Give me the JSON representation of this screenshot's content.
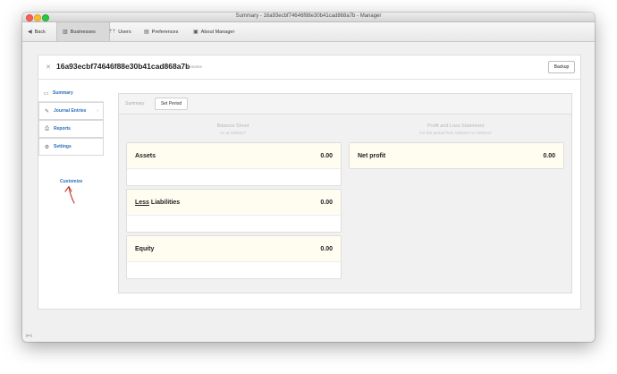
{
  "window": {
    "title": "Summary - 16a93ecbf74646f88e30b41cad868a7b - Manager"
  },
  "toolbar": {
    "back_label": "Back",
    "businesses_label": "Businesses",
    "users_label": "Users",
    "preferences_label": "Preferences",
    "about_label": "About Manager"
  },
  "business": {
    "name": "16a93ecbf74646f88e30b41cad868a7b",
    "rename_label": "Rename",
    "backup_label": "Backup"
  },
  "sidebar": {
    "items": [
      {
        "label": "Summary",
        "icon": "monitor-icon"
      },
      {
        "label": "Journal Entries",
        "icon": "pen-icon"
      },
      {
        "label": "Reports",
        "icon": "printer-icon"
      },
      {
        "label": "Settings",
        "icon": "gears-icon"
      }
    ],
    "customize_label": "Customize"
  },
  "summary": {
    "tab_summary": "Summary",
    "tab_set_period": "Set Period",
    "balance_sheet": {
      "heading": "Balance Sheet",
      "subheading": "As at 1/8/2017",
      "assets_label": "Assets",
      "assets_value": "0.00",
      "liabilities_prefix": "Less",
      "liabilities_label": " Liabilities",
      "liabilities_value": "0.00",
      "equity_label": "Equity",
      "equity_value": "0.00"
    },
    "profit_loss": {
      "heading": "Profit and Loss Statement",
      "subheading": "For the period from 1/8/2017 to 1/8/2017",
      "net_profit_label": "Net profit",
      "net_profit_value": "0.00"
    }
  },
  "footer": {
    "tag": "[en]"
  },
  "colors": {
    "accent": "#2a6ebb",
    "card_highlight": "#fffdf0",
    "annotation_arrow": "#c0392b"
  }
}
